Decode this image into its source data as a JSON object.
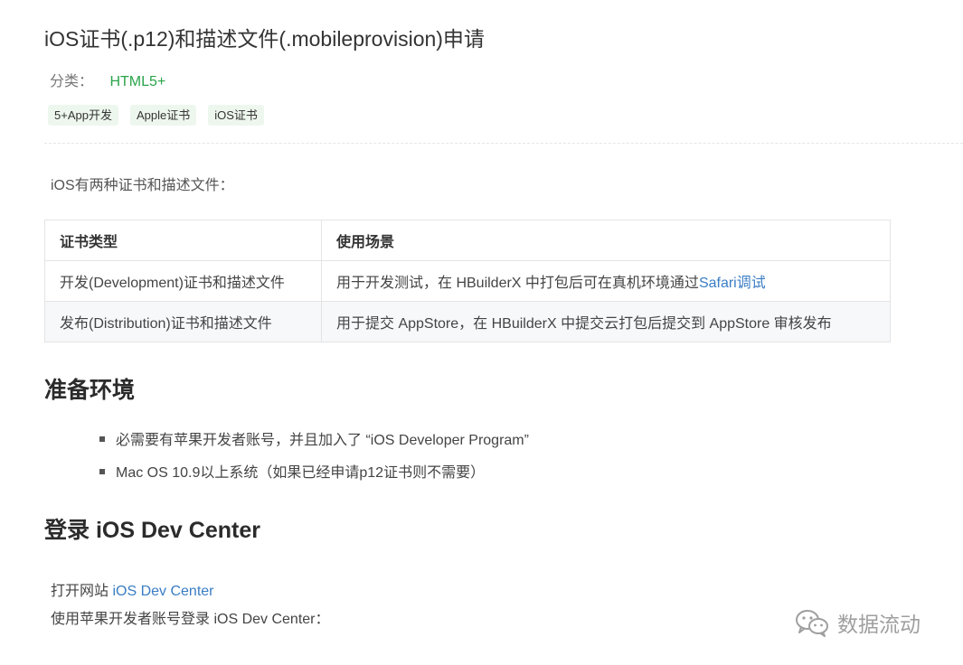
{
  "title": "iOS证书(.p12)和描述文件(.mobileprovision)申请",
  "category": {
    "label": "分类：",
    "value": "HTML5+"
  },
  "tags": [
    "5+App开发",
    "Apple证书",
    "iOS证书"
  ],
  "intro": "iOS有两种证书和描述文件：",
  "table": {
    "headers": [
      "证书类型",
      "使用场景"
    ],
    "rows": [
      {
        "type": "开发(Development)证书和描述文件",
        "usage": "用于开发测试，在 HBuilderX 中打包后可在真机环境通过",
        "usage_link": "Safari调试"
      },
      {
        "type": "发布(Distribution)证书和描述文件",
        "usage": "用于提交 AppStore，在 HBuilderX 中提交云打包后提交到 AppStore 审核发布",
        "usage_link": ""
      }
    ]
  },
  "section_env": {
    "heading": "准备环境",
    "items": [
      "必需要有苹果开发者账号，并且加入了 “iOS Developer Program”",
      "Mac OS 10.9以上系统（如果已经申请p12证书则不需要）"
    ]
  },
  "section_login": {
    "heading": "登录 iOS Dev Center",
    "open_prefix": "打开网站 ",
    "open_link": "iOS Dev Center",
    "login_text": "使用苹果开发者账号登录 iOS Dev Center："
  },
  "watermark": {
    "icon": "wechat-icon",
    "text": "数据流动"
  }
}
